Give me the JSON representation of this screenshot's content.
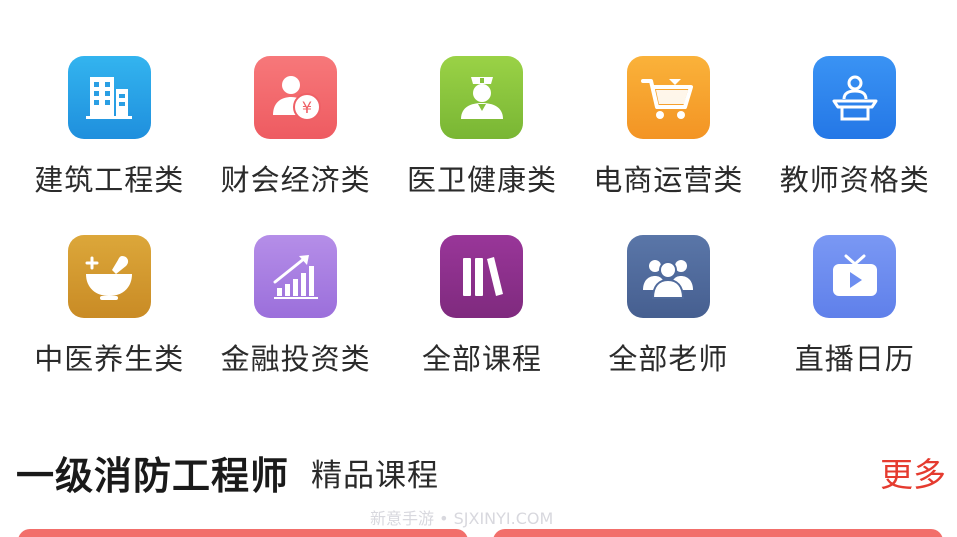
{
  "categories": [
    {
      "label": "建筑工程类",
      "icon": "building-icon",
      "color": "#2aa6e8"
    },
    {
      "label": "财会经济类",
      "icon": "accountant-icon",
      "color": "#f26a6e"
    },
    {
      "label": "医卫健康类",
      "icon": "nurse-icon",
      "color": "#8cc63f"
    },
    {
      "label": "电商运营类",
      "icon": "shopping-cart-icon",
      "color": "#f6a52b"
    },
    {
      "label": "教师资格类",
      "icon": "teacher-podium-icon",
      "color": "#2f87f0"
    },
    {
      "label": "中医养生类",
      "icon": "mortar-icon",
      "color": "#d49a2e"
    },
    {
      "label": "金融投资类",
      "icon": "growth-chart-icon",
      "color": "#a77fe0"
    },
    {
      "label": "全部课程",
      "icon": "books-icon",
      "color": "#8e2f8a"
    },
    {
      "label": "全部老师",
      "icon": "people-group-icon",
      "color": "#4f6a9c"
    },
    {
      "label": "直播日历",
      "icon": "tv-play-icon",
      "color": "#6d8ef0"
    }
  ],
  "section": {
    "title": "一级消防工程师",
    "subtitle": "精品课程",
    "more_label": "更多"
  },
  "watermark": "新意手游 • SJXINYI.COM"
}
